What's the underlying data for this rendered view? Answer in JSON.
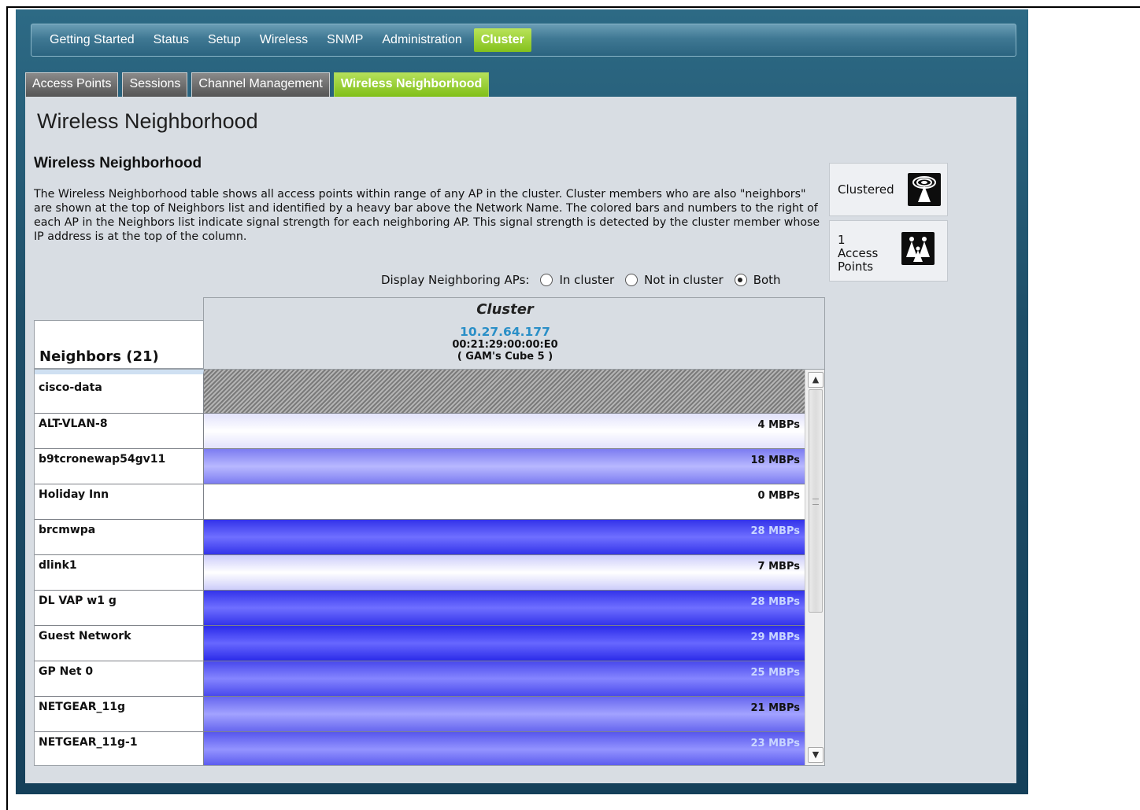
{
  "nav": {
    "items": [
      {
        "label": "Getting Started"
      },
      {
        "label": "Status"
      },
      {
        "label": "Setup"
      },
      {
        "label": "Wireless"
      },
      {
        "label": "SNMP"
      },
      {
        "label": "Administration"
      },
      {
        "label": "Cluster",
        "active": true
      }
    ]
  },
  "sub_tabs": [
    {
      "label": "Access Points"
    },
    {
      "label": "Sessions"
    },
    {
      "label": "Channel Management"
    },
    {
      "label": "Wireless Neighborhood",
      "active": true
    }
  ],
  "page": {
    "title": "Wireless Neighborhood",
    "section_title": "Wireless Neighborhood",
    "description": "The Wireless Neighborhood table shows all access points within range of any AP in the cluster. Cluster members who are also \"neighbors\" are shown at the top of Neighbors list and identified by a heavy bar above the Network Name. The colored bars and numbers to the right of each AP in the Neighbors list indicate signal strength for each neighboring AP. This signal strength is detected by the cluster member whose IP address is at the top of the column."
  },
  "filter": {
    "label": "Display Neighboring APs:",
    "options": [
      {
        "label": "In cluster",
        "checked": false
      },
      {
        "label": "Not in cluster",
        "checked": false
      },
      {
        "label": "Both",
        "checked": true
      }
    ]
  },
  "side_status": {
    "clustered_label": "Clustered",
    "clustered_icon": "cluster-antenna-icon",
    "ap_count": "1",
    "ap_line1": "Access",
    "ap_line2": "Points",
    "ap_icon": "access-points-icon"
  },
  "table": {
    "neighbors_header": "Neighbors (21)",
    "cluster_header": "Cluster",
    "member": {
      "ip": "10.27.64.177",
      "mac": "00:21:29:00:00:E0",
      "name": "( GAM's Cube 5 )"
    },
    "rows": [
      {
        "name": "cisco-data",
        "rate": "",
        "strength": null,
        "member": true
      },
      {
        "name": "ALT-VLAN-8",
        "rate": "4 MBPs",
        "strength": 4
      },
      {
        "name": "b9tcronewap54gv11",
        "rate": "18 MBPs",
        "strength": 18
      },
      {
        "name": "Holiday Inn",
        "rate": "0 MBPs",
        "strength": 0
      },
      {
        "name": "brcmwpa",
        "rate": "28 MBPs",
        "strength": 28
      },
      {
        "name": "dlink1",
        "rate": "7 MBPs",
        "strength": 7
      },
      {
        "name": "DL VAP w1 g",
        "rate": "28 MBPs",
        "strength": 28
      },
      {
        "name": "Guest Network",
        "rate": "29 MBPs",
        "strength": 29
      },
      {
        "name": "GP Net 0",
        "rate": "25 MBPs",
        "strength": 25
      },
      {
        "name": "NETGEAR_11g",
        "rate": "21 MBPs",
        "strength": 21
      },
      {
        "name": "NETGEAR_11g-1",
        "rate": "23 MBPs",
        "strength": 23
      }
    ]
  },
  "colors": {
    "accent_green": "#84c11c",
    "link_blue": "#2a8fc7",
    "bar_strong": "#2424e8",
    "bar_weak": "#ffffff"
  }
}
